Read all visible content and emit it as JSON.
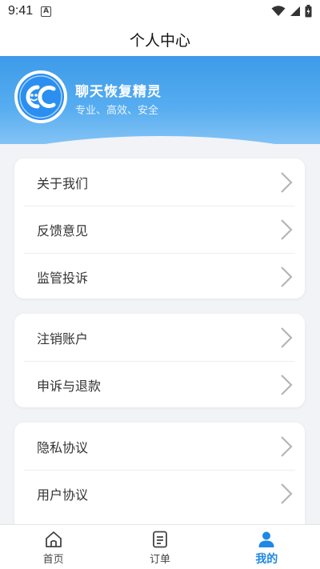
{
  "status": {
    "time": "9:41",
    "badge": "A"
  },
  "header": {
    "title": "个人中心"
  },
  "profile": {
    "app_name": "聊天恢复精灵",
    "slogan": "专业、高效、安全"
  },
  "groups": [
    {
      "items": [
        {
          "label": "关于我们"
        },
        {
          "label": "反馈意见"
        },
        {
          "label": "监管投诉"
        }
      ]
    },
    {
      "items": [
        {
          "label": "注销账户"
        },
        {
          "label": "申诉与退款"
        }
      ]
    },
    {
      "items": [
        {
          "label": "隐私协议"
        },
        {
          "label": "用户协议"
        }
      ]
    }
  ],
  "nav": [
    {
      "label": "首页",
      "icon": "home-icon"
    },
    {
      "label": "订单",
      "icon": "order-icon"
    },
    {
      "label": "我的",
      "icon": "user-icon",
      "active": true
    }
  ],
  "colors": {
    "accent": "#1e88e5",
    "banner": "#4aa3ee",
    "background": "#f1f3f7"
  }
}
